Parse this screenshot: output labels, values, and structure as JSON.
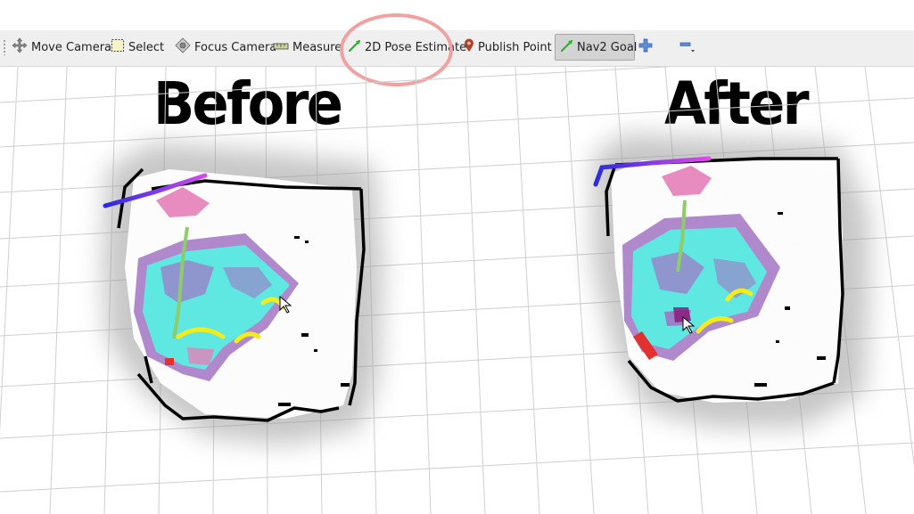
{
  "toolbar": {
    "tools": [
      {
        "label": "Move Camera",
        "icon": "move-camera-icon"
      },
      {
        "label": "Select",
        "icon": "select-icon"
      },
      {
        "label": "Focus Camera",
        "icon": "focus-camera-icon"
      },
      {
        "label": "Measure",
        "icon": "measure-icon"
      },
      {
        "label": "2D Pose Estimate",
        "icon": "pose-arrow-icon"
      },
      {
        "label": "Publish Point",
        "icon": "map-pin-icon"
      },
      {
        "label": "Nav2 Goal",
        "icon": "goal-arrow-icon",
        "active": true
      }
    ],
    "extra_icons": [
      "add-tool-icon",
      "remove-tool-icon"
    ]
  },
  "labels": {
    "before": "Before",
    "after": "After"
  },
  "annotation": {
    "highlighted_tool": "2D Pose Estimate",
    "color": "#f0a2a0"
  },
  "colors": {
    "costmap_cyan": "#5fe8e2",
    "costmap_purple": "#a274c4",
    "inflation_pink": "#e580b8",
    "wall": "#000000",
    "obstacle_yellow": "#f3ec1c",
    "path_blue": "#2a2ae0",
    "path_magenta": "#d34bf0",
    "goal_red": "#e53030",
    "grid": "#cfcfcf"
  }
}
